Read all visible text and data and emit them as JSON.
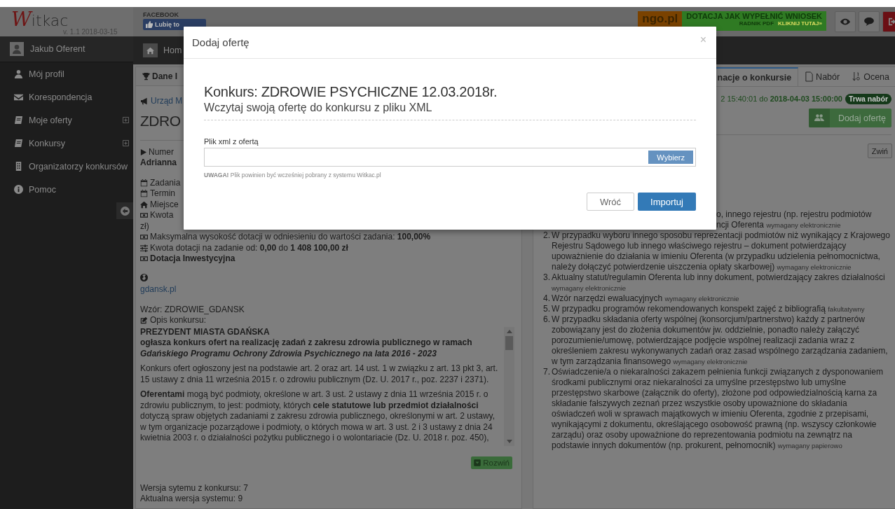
{
  "header": {
    "logo_initial": "W",
    "logo_rest": "itkac",
    "version": "v. 1.1 2018-03-15",
    "facebook_label": "FACEBOOK",
    "like_button": "Lubię to",
    "banner": {
      "brand": "ngo.pl",
      "headline_1": "DOTACJA",
      "headline_2": "JAK WYPEŁNIĆ WNIOSEK",
      "subline": "RADNIK PDF",
      "cta": "KLIKNIJ TUTAJ»"
    }
  },
  "sidebar": {
    "user": "Jakub Oferent",
    "items": [
      {
        "label": "Mój profil",
        "kind": "user",
        "expandable": false
      },
      {
        "label": "Korespondencja",
        "kind": "mail",
        "expandable": false
      },
      {
        "label": "Moje oferty",
        "kind": "book",
        "expandable": true
      },
      {
        "label": "Konkursy",
        "kind": "book",
        "expandable": true
      },
      {
        "label": "Organizatorzy konkursów",
        "kind": "building",
        "expandable": false
      },
      {
        "label": "Pomoc",
        "kind": "info",
        "expandable": false
      }
    ]
  },
  "breadcrumb": "Hom",
  "left_panel": {
    "header": "Dane I",
    "office_link": "Urząd M",
    "title": "ZDRO",
    "number_label": "Numer",
    "organizer": "Adrianna",
    "details": [
      {
        "kind": "calendar",
        "text": "Zadania",
        "bold": false
      },
      {
        "kind": "calendar",
        "text": "Termin",
        "bold": false
      },
      {
        "kind": "home",
        "text": "Miejsce",
        "bold": false
      },
      {
        "kind": "money",
        "text": "Kwota",
        "bold": false
      },
      {
        "kind": "none",
        "text": "zł)",
        "bold": false
      },
      {
        "kind": "money",
        "text": "Maksymalna wysokość dotacji w odniesieniu do wartości zadania: **100,00%**",
        "bold": false
      },
      {
        "kind": "sliders",
        "text": "Kwota dotacji na zadanie od: **0,00** do **1 408 100,00 zł**",
        "bold": false
      },
      {
        "kind": "money",
        "text": "Dotacja Inwestycyjna",
        "bold": true
      }
    ],
    "website": "gdansk.pl",
    "template": "Wzór: ZDROWIE_GDANSK",
    "description_label": "Opis konkursu:",
    "description": [
      {
        "kind": "heading",
        "text": "PREZYDENT MIASTA GDAŃSKA"
      },
      {
        "kind": "lead",
        "text": "ogłasza konkurs ofert na realizację zadań z zakresu zdrowia publicznego w ramach *Gdańskiego Programu Ochrony Zdrowia Psychicznego na lata 2016 - 2023*"
      },
      {
        "kind": "paragraph",
        "text": "Konkurs ofert ogłoszony jest na podstawie art. 2 oraz art. 14 ust. 1 w związku z art. 13 pkt 3, art. 15 ustawy z dnia 11 września 2015 r. o zdrowiu publicznym (Dz. U. 2017 r., poz. 2237 i 2371)."
      },
      {
        "kind": "paragraph",
        "text": "**Oferentami** mogą być podmioty, określone w art. 3 ust. 2 ustawy z dnia 11 września 2015 r. o zdrowiu publicznym, to jest: podmioty, których **cele statutowe lub przedmiot działalności** dotyczą spraw objętych zadaniami z zakresu zdrowia publicznego, określonymi w art. 2 ustawy, w tym organizacje pozarządowe i podmioty, o których mowa w art. 3 ust. 2 i 3 ustawy z dnia 24 kwietnia 2003 r. o działalności pożytku publicznego i o wolontariacie  (Dz. U. 2018 r. poz. 450),"
      }
    ],
    "expand_button": "Rozwiń",
    "versions": [
      "Wersja sytemu z konkursu: 7",
      "Aktualna wersja systemu: 9"
    ]
  },
  "right_panel": {
    "tabs": [
      {
        "label": "nacje o konkursie",
        "kind": "none",
        "selected": true
      },
      {
        "label": "Nabór",
        "kind": "document",
        "selected": false
      },
      {
        "label": "Ocena",
        "kind": "sort",
        "selected": false
      }
    ],
    "dates": "2 15:40:01 do **2018-04-03 15:00:00**",
    "status_badge": "Trwa nabór",
    "add_offer_button": "Dodaj ofertę",
    "collapse_button": "Zwiń",
    "partial_lines": [
      "o, innego rejestru (np. rejestru podmiotów",
      "ncji Oferenta"
    ],
    "partial_note": "wymagany elektronicznie",
    "documents": [
      {
        "number": "2.",
        "text": "W przypadku wyboru innego sposobu reprezentacji podmiotów niż wynikający z Krajowego Rejestru Sądowego lub innego właściwego rejestru – dokument potwierdzający upoważnienie do działania w imieniu Oferenta (w przypadku udzielenia pełnomocnictwa, należy dołączyć potwierdzenie uiszczenia opłaty skarbowej)",
        "note": "wymagany elektronicznie"
      },
      {
        "number": "3.",
        "text": "Aktualny statut/regulamin Oferenta lub inny dokument, potwierdzający zakres działalności",
        "note": "wymagany elektronicznie"
      },
      {
        "number": "4.",
        "text": "Wzór narzędzi ewaluacyjnych",
        "note": "wymagany elektronicznie"
      },
      {
        "number": "5.",
        "text": "W przypadku programów rekomendowanych konspekt zajęć z bibliografią",
        "note": "fakultatywny"
      },
      {
        "number": "6.",
        "text": "W przypadku składania oferty wspólnej (konsorcjum/partnerstwo) każdy z partnerów zobowiązany jest do złożenia dokumentów jw. oddzielnie, ponadto należy załączyć porozumienie/umowę, potwierdzające podjęcie wspólnej realizacji zadania wraz z określeniem zakresu wykonywanych zadań oraz zasad wspólnego zarządzania zadaniem, w tym zarządzania finansowego",
        "note": "wymagany elektronicznie"
      },
      {
        "number": "7.",
        "text": "Oświadczenie/a o niekaralności zakazem pełnienia funkcji związanych z dysponowaniem środkami publicznymi oraz niekaralności za umyślne przestępstwo lub umyślne przestępstwo skarbowe (załącznik do oferty), złożone pod odpowiedzialnością karna za składanie fałszywych zeznań przez wszystkie osoby upoważnione do składania oświadczeń woli w sprawach majątkowych w imieniu Oferenta, zgodnie z przepisami, wynikającymi z dokumentu, określającego osobowość prawną (np. wszyscy członkowie zarządu) oraz osoby upoważnione do reprezentowania podmiotu na zewnątrz na podstawie innych dokumentów (np. prokurent, pełnomocnik)",
        "note": "wymagany papierowo"
      }
    ]
  },
  "modal": {
    "title": "Dodaj ofertę",
    "close": "×",
    "heading": "Konkurs: ZDROWIE PSYCHICZNE 12.03.2018r.",
    "subheading": "Wczytaj swoją ofertę do konkursu z pliku XML",
    "field_label": "Plik xml z ofertą",
    "browse_button": "Wybierz",
    "note": "**UWAGA!** Plik powinien być wcześniej pobrany z systemu Witkac.pl",
    "buttons": [
      {
        "label": "Wróć",
        "kind": "secondary"
      },
      {
        "label": "Importuj",
        "kind": "primary"
      }
    ]
  }
}
